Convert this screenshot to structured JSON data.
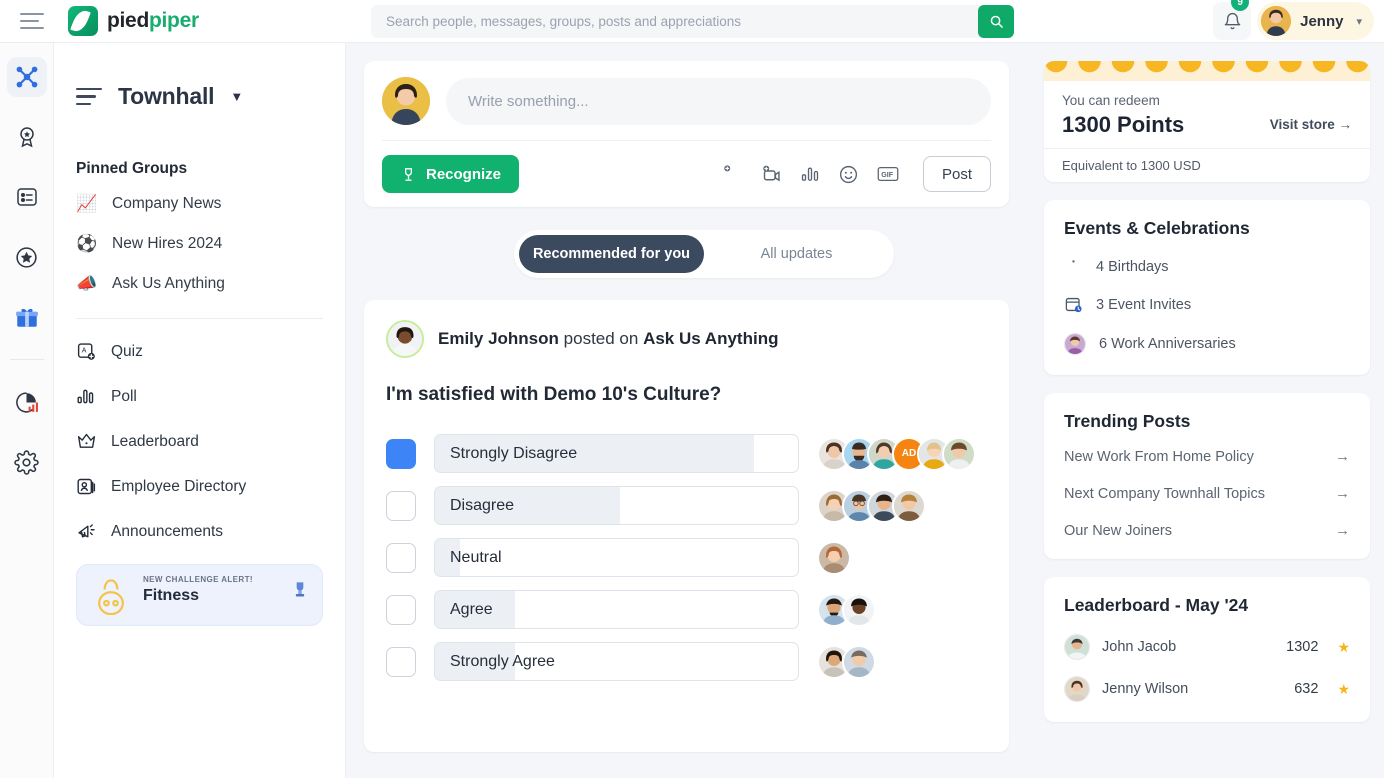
{
  "topbar": {
    "brand_first": "pied",
    "brand_second": "piper",
    "search_placeholder": "Search people, messages, groups, posts and appreciations",
    "search_value": "",
    "notification_count": "9",
    "user_name": "Jenny"
  },
  "rail": [
    {
      "name": "network-icon",
      "active": true
    },
    {
      "name": "badge-icon",
      "active": false
    },
    {
      "name": "list-icon",
      "active": false
    },
    {
      "name": "star-icon",
      "active": false
    },
    {
      "name": "gift-icon",
      "active": false
    },
    {
      "name": "analytics-icon",
      "active": false
    },
    {
      "name": "gear-icon",
      "active": false
    }
  ],
  "left": {
    "title": "Townhall",
    "section_title": "Pinned Groups",
    "groups": [
      {
        "emoji": "📈",
        "label": "Company News"
      },
      {
        "emoji": "⚽",
        "label": "New Hires 2024"
      },
      {
        "emoji": "📣",
        "label": "Ask Us Anything"
      }
    ],
    "nav": [
      {
        "icon": "quiz-icon",
        "label": "Quiz"
      },
      {
        "icon": "poll-icon",
        "label": "Poll"
      },
      {
        "icon": "leaderboard-icon",
        "label": "Leaderboard"
      },
      {
        "icon": "directory-icon",
        "label": "Employee Directory"
      },
      {
        "icon": "announcement-icon",
        "label": "Announcements"
      }
    ],
    "challenge": {
      "alert": "NEW CHALLENGE ALERT!",
      "title": "Fitness"
    }
  },
  "composer": {
    "placeholder": "Write something...",
    "value": "",
    "recognize_label": "Recognize",
    "post_label": "Post",
    "actions": [
      "add-photo-icon",
      "add-video-icon",
      "poll-icon",
      "emoji-icon",
      "gif-icon"
    ]
  },
  "feed_tabs": [
    {
      "label": "Recommended for you",
      "active": true
    },
    {
      "label": "All updates",
      "active": false
    }
  ],
  "post": {
    "author": "Emily Johnson",
    "posted_on_text": "posted on",
    "group": "Ask Us Anything",
    "question": "I'm satisfied with Demo 10's Culture?",
    "options": [
      {
        "label": "Strongly Disagree",
        "selected": true,
        "fill_percent": 88,
        "voters": 6,
        "initials": "AD"
      },
      {
        "label": "Disagree",
        "selected": false,
        "fill_percent": 51,
        "voters": 4,
        "initials": ""
      },
      {
        "label": "Neutral",
        "selected": false,
        "fill_percent": 7,
        "voters": 1,
        "initials": ""
      },
      {
        "label": "Agree",
        "selected": false,
        "fill_percent": 22,
        "voters": 2,
        "initials": ""
      },
      {
        "label": "Strongly Agree",
        "selected": false,
        "fill_percent": 22,
        "voters": 2,
        "initials": ""
      }
    ]
  },
  "points": {
    "redeem_label": "You can redeem",
    "amount": "1300 Points",
    "visit_store": "Visit store",
    "equivalent": "Equivalent to 1300 USD"
  },
  "events": {
    "title": "Events & Celebrations",
    "items": [
      {
        "icon": "cake-icon",
        "label": "4 Birthdays"
      },
      {
        "icon": "calendar-icon",
        "label": "3 Event Invites"
      },
      {
        "icon": "avatar-icon",
        "label": "6 Work Anniversaries"
      }
    ]
  },
  "trending": {
    "title": "Trending Posts",
    "items": [
      {
        "label": "New Work From Home Policy"
      },
      {
        "label": "Next Company Townhall Topics"
      },
      {
        "label": "Our New Joiners"
      }
    ]
  },
  "leaderboard": {
    "title": "Leaderboard - May '24",
    "items": [
      {
        "name": "John Jacob",
        "points": "1302"
      },
      {
        "name": "Jenny Wilson",
        "points": "632"
      }
    ]
  },
  "colors": {
    "brand_green": "#11b16f",
    "accent_blue": "#3d85f7",
    "tab_dark": "#3c4a5f",
    "points_yellow": "#f6b723",
    "star_gold": "#f5b619"
  }
}
